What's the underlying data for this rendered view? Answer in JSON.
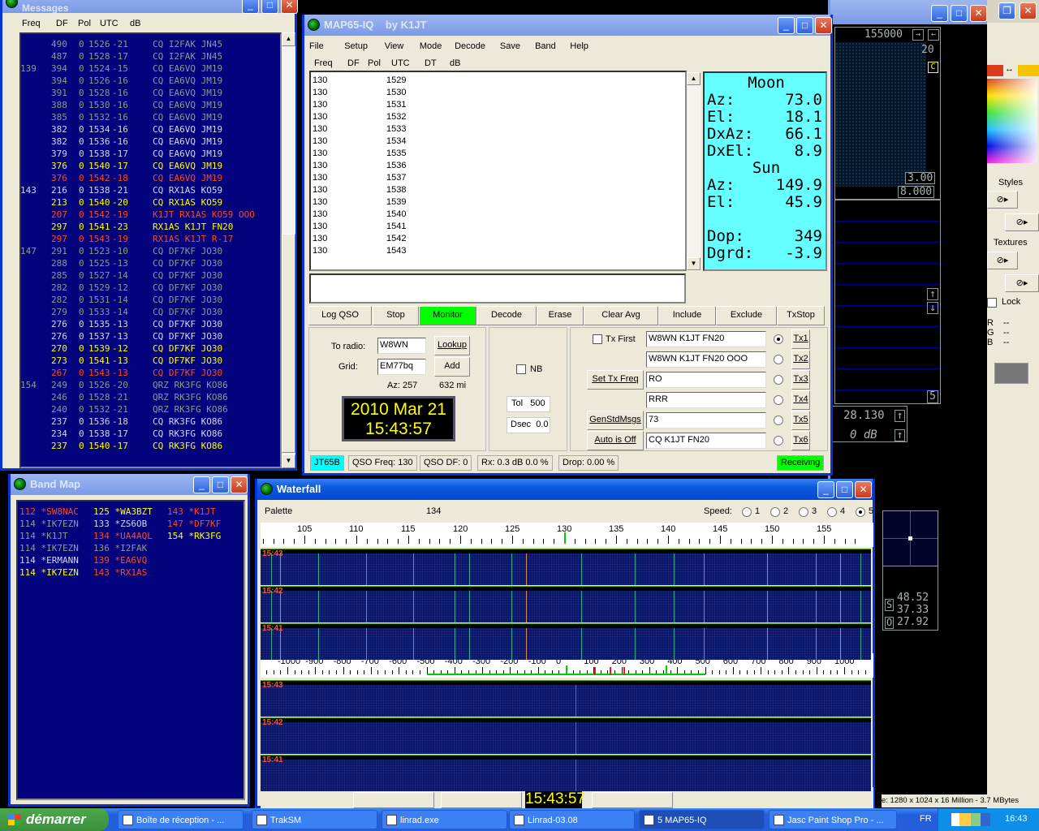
{
  "messages": {
    "title": "Messages",
    "headers": [
      "Freq",
      "DF",
      "Pol",
      "UTC",
      "dB"
    ],
    "colors": {
      "old": "#8c9c8c",
      "recent": "#d4d8e8",
      "current": "#ffff00",
      "tx": "#ff4a1a"
    },
    "rows": [
      [
        "",
        "490",
        "0",
        "1526",
        "-21",
        "CQ I2FAK JN45",
        "old"
      ],
      [
        "",
        "487",
        "0",
        "1528",
        "-17",
        "CQ I2FAK JN45",
        "old"
      ],
      [
        "139",
        "394",
        "0",
        "1524",
        "-15",
        "CQ EA6VQ JM19",
        "old"
      ],
      [
        "",
        "394",
        "0",
        "1526",
        "-16",
        "CQ EA6VQ JM19",
        "old"
      ],
      [
        "",
        "391",
        "0",
        "1528",
        "-16",
        "CQ EA6VQ JM19",
        "old"
      ],
      [
        "",
        "388",
        "0",
        "1530",
        "-16",
        "CQ EA6VQ JM19",
        "old"
      ],
      [
        "",
        "385",
        "0",
        "1532",
        "-16",
        "CQ EA6VQ JM19",
        "old"
      ],
      [
        "",
        "382",
        "0",
        "1534",
        "-16",
        "CQ EA6VQ JM19",
        "recent"
      ],
      [
        "",
        "382",
        "0",
        "1536",
        "-16",
        "CQ EA6VQ JM19",
        "recent"
      ],
      [
        "",
        "379",
        "0",
        "1538",
        "-17",
        "CQ EA6VQ JM19",
        "recent"
      ],
      [
        "",
        "376",
        "0",
        "1540",
        "-17",
        "CQ EA6VQ JM19",
        "current"
      ],
      [
        "",
        "376",
        "0",
        "1542",
        "-18",
        "CQ EA6VQ JM19",
        "tx"
      ],
      [
        "143",
        "216",
        "0",
        "1538",
        "-21",
        "CQ RX1AS KO59",
        "recent"
      ],
      [
        "",
        "213",
        "0",
        "1540",
        "-20",
        "CQ RX1AS KO59",
        "current"
      ],
      [
        "",
        "207",
        "0",
        "1542",
        "-19",
        "K1JT RX1AS KO59 OOO",
        "tx"
      ],
      [
        "",
        "297",
        "0",
        "1541",
        "-23",
        "RX1AS K1JT FN20",
        "current"
      ],
      [
        "",
        "297",
        "0",
        "1543",
        "-19",
        "RX1AS K1JT R-17",
        "tx"
      ],
      [
        "147",
        "291",
        "0",
        "1523",
        "-10",
        "CQ DF7KF JO30",
        "old"
      ],
      [
        "",
        "288",
        "0",
        "1525",
        "-13",
        "CQ DF7KF JO30",
        "old"
      ],
      [
        "",
        "285",
        "0",
        "1527",
        "-14",
        "CQ DF7KF JO30",
        "old"
      ],
      [
        "",
        "282",
        "0",
        "1529",
        "-12",
        "CQ DF7KF JO30",
        "old"
      ],
      [
        "",
        "282",
        "0",
        "1531",
        "-14",
        "CQ DF7KF JO30",
        "old"
      ],
      [
        "",
        "279",
        "0",
        "1533",
        "-14",
        "CQ DF7KF JO30",
        "old"
      ],
      [
        "",
        "276",
        "0",
        "1535",
        "-13",
        "CQ DF7KF JO30",
        "recent"
      ],
      [
        "",
        "276",
        "0",
        "1537",
        "-13",
        "CQ DF7KF JO30",
        "recent"
      ],
      [
        "",
        "270",
        "0",
        "1539",
        "-12",
        "CQ DF7KF JO30",
        "current"
      ],
      [
        "",
        "273",
        "0",
        "1541",
        "-13",
        "CQ DF7KF JO30",
        "current"
      ],
      [
        "",
        "267",
        "0",
        "1543",
        "-13",
        "CQ DF7KF JO30",
        "tx"
      ],
      [
        "154",
        "249",
        "0",
        "1526",
        "-20",
        "QRZ RK3FG KO86",
        "old"
      ],
      [
        "",
        "246",
        "0",
        "1528",
        "-21",
        "QRZ RK3FG KO86",
        "old"
      ],
      [
        "",
        "240",
        "0",
        "1532",
        "-21",
        "QRZ RK3FG KO86",
        "old"
      ],
      [
        "",
        "237",
        "0",
        "1536",
        "-18",
        "CQ RK3FG KO86",
        "recent"
      ],
      [
        "",
        "234",
        "0",
        "1538",
        "-17",
        "CQ RK3FG KO86",
        "recent"
      ],
      [
        "",
        "237",
        "0",
        "1540",
        "-17",
        "CQ RK3FG KO86",
        "current"
      ]
    ]
  },
  "bandmap": {
    "title": "Band Map",
    "columns": [
      [
        [
          "112",
          "*SW8NAC",
          "tx"
        ],
        [
          "114",
          "*IK7EZN",
          "old"
        ],
        [
          "114",
          "*K1JT",
          "old"
        ],
        [
          "114",
          "*IK7EZN",
          "old"
        ],
        [
          "114",
          "*ERMANN",
          "recent"
        ],
        [
          "114",
          "*IK7EZN",
          "current"
        ]
      ],
      [
        [
          "125",
          "*WA3BZT",
          "current"
        ],
        [
          "133",
          "*ZS6OB",
          "recent"
        ],
        [
          "134",
          "*UA4AQL",
          "tx"
        ],
        [
          "136",
          "*I2FAK",
          "old"
        ],
        [
          "139",
          "*EA6VQ",
          "tx"
        ],
        [
          "143",
          "*RX1AS",
          "tx"
        ]
      ],
      [
        [
          "143",
          "*K1JT",
          "tx"
        ],
        [
          "147",
          "*DF7KF",
          "tx"
        ],
        [
          "154",
          "*RK3FG",
          "current"
        ]
      ]
    ]
  },
  "map65": {
    "title": "MAP65-IQ",
    "subtitle": "by K1JT",
    "menu": [
      "File",
      "Setup",
      "View",
      "Mode",
      "Decode",
      "Save",
      "Band",
      "Help"
    ],
    "headers": [
      "Freq",
      "DF",
      "Pol",
      "UTC",
      "DT",
      "dB"
    ],
    "rows": [
      [
        "130",
        "1529"
      ],
      [
        "130",
        "1530"
      ],
      [
        "130",
        "1531"
      ],
      [
        "130",
        "1532"
      ],
      [
        "130",
        "1533"
      ],
      [
        "130",
        "1534"
      ],
      [
        "130",
        "1535"
      ],
      [
        "130",
        "1536"
      ],
      [
        "130",
        "1537"
      ],
      [
        "130",
        "1538"
      ],
      [
        "130",
        "1539"
      ],
      [
        "130",
        "1540"
      ],
      [
        "130",
        "1541"
      ],
      [
        "130",
        "1542"
      ],
      [
        "130",
        "1543"
      ]
    ],
    "astro": {
      "moon": "Moon",
      "az_l": "Az:",
      "az": "73.0",
      "el_l": "El:",
      "el": "18.1",
      "dxaz_l": "DxAz:",
      "dxaz": "66.1",
      "dxel_l": "DxEl:",
      "dxel": "8.9",
      "sun": "Sun",
      "saz": "149.9",
      "sel": "45.9",
      "dop_l": "Dop:",
      "dop": "349",
      "dgrd_l": "Dgrd:",
      "dgrd": "-3.9"
    },
    "buttons": [
      "Log QSO",
      "Stop",
      "Monitor",
      "Decode",
      "Erase",
      "Clear Avg",
      "Include",
      "Exclude",
      "TxStop"
    ],
    "to_radio_label": "To radio:",
    "to_radio": "W8WN",
    "lookup": "Lookup",
    "grid_label": "Grid:",
    "grid": "EM77bq",
    "add": "Add",
    "az": "Az: 257",
    "dist": "632 mi",
    "date": "2010 Mar 21",
    "time": "15:43:57",
    "nb": "NB",
    "tol_label": "Tol",
    "tol": "500",
    "dsec_label": "Dsec",
    "dsec": "0.0",
    "tx_first": "Tx First",
    "set_tx_freq": "Set Tx Freq",
    "gen_std": "GenStdMsgs",
    "auto": "Auto is Off",
    "tx_msgs": [
      "W8WN K1JT FN20",
      "W8WN K1JT FN20 OOO",
      "RO",
      "RRR",
      "73",
      "CQ K1JT FN20"
    ],
    "tx_buttons": [
      "Tx1",
      "Tx2",
      "Tx3",
      "Tx4",
      "Tx5",
      "Tx6"
    ],
    "tx_selected": 0,
    "status": {
      "mode": "JT65B",
      "qso_freq": "QSO Freq: 130",
      "qso_df": "QSO DF:   0",
      "rx": "Rx: 0.3 dB  0.0 %",
      "drop": "Drop: 0.00 %",
      "state": "Receiving"
    },
    "accent_green": "#00ff00",
    "accent_cyan": "#00ffff"
  },
  "waterfall": {
    "title": "Waterfall",
    "palette": "Palette",
    "center": "134",
    "speed_label": "Speed:",
    "speeds": [
      "1",
      "2",
      "3",
      "4",
      "5"
    ],
    "speed_selected": 4,
    "upper_ticks": [
      "105",
      "110",
      "115",
      "120",
      "125",
      "130",
      "135",
      "140",
      "145",
      "150",
      "155"
    ],
    "lower_ticks": [
      "-1000",
      "-900",
      "-800",
      "-700",
      "-600",
      "-500",
      "-400",
      "-300",
      "-200",
      "-100",
      "0",
      "100",
      "200",
      "300",
      "400",
      "500",
      "600",
      "700",
      "800",
      "900",
      "1000"
    ],
    "times": [
      "15:43",
      "15:42",
      "15:41"
    ],
    "clock": "15:43:57"
  },
  "linrad": {
    "freq": "155000",
    "top": "20",
    "c": "C",
    "v1": "3.00",
    "v2": "8.000",
    "n5": "5",
    "f": "28.130",
    "db": "0 dB",
    "s_label": "S",
    "o_label": "O",
    "s1": "48.52",
    "s2": "37.33",
    "s3": "27.92"
  },
  "psp": {
    "styles": "Styles",
    "textures": "Textures",
    "lock": "Lock",
    "r": "R",
    "g": "G",
    "b": "B",
    "dash": "--",
    "status": "e: 1280 x 1024 x 16 Million - 3.7 MBytes"
  },
  "taskbar": {
    "start": "démarrer",
    "items": [
      "Boîte de réception - ...",
      "TrakSM",
      "linrad.exe",
      "Linrad-03.08",
      "5 MAP65-IQ",
      "Jasc Paint Shop Pro - ..."
    ],
    "lang": "FR",
    "time": "16:43"
  }
}
